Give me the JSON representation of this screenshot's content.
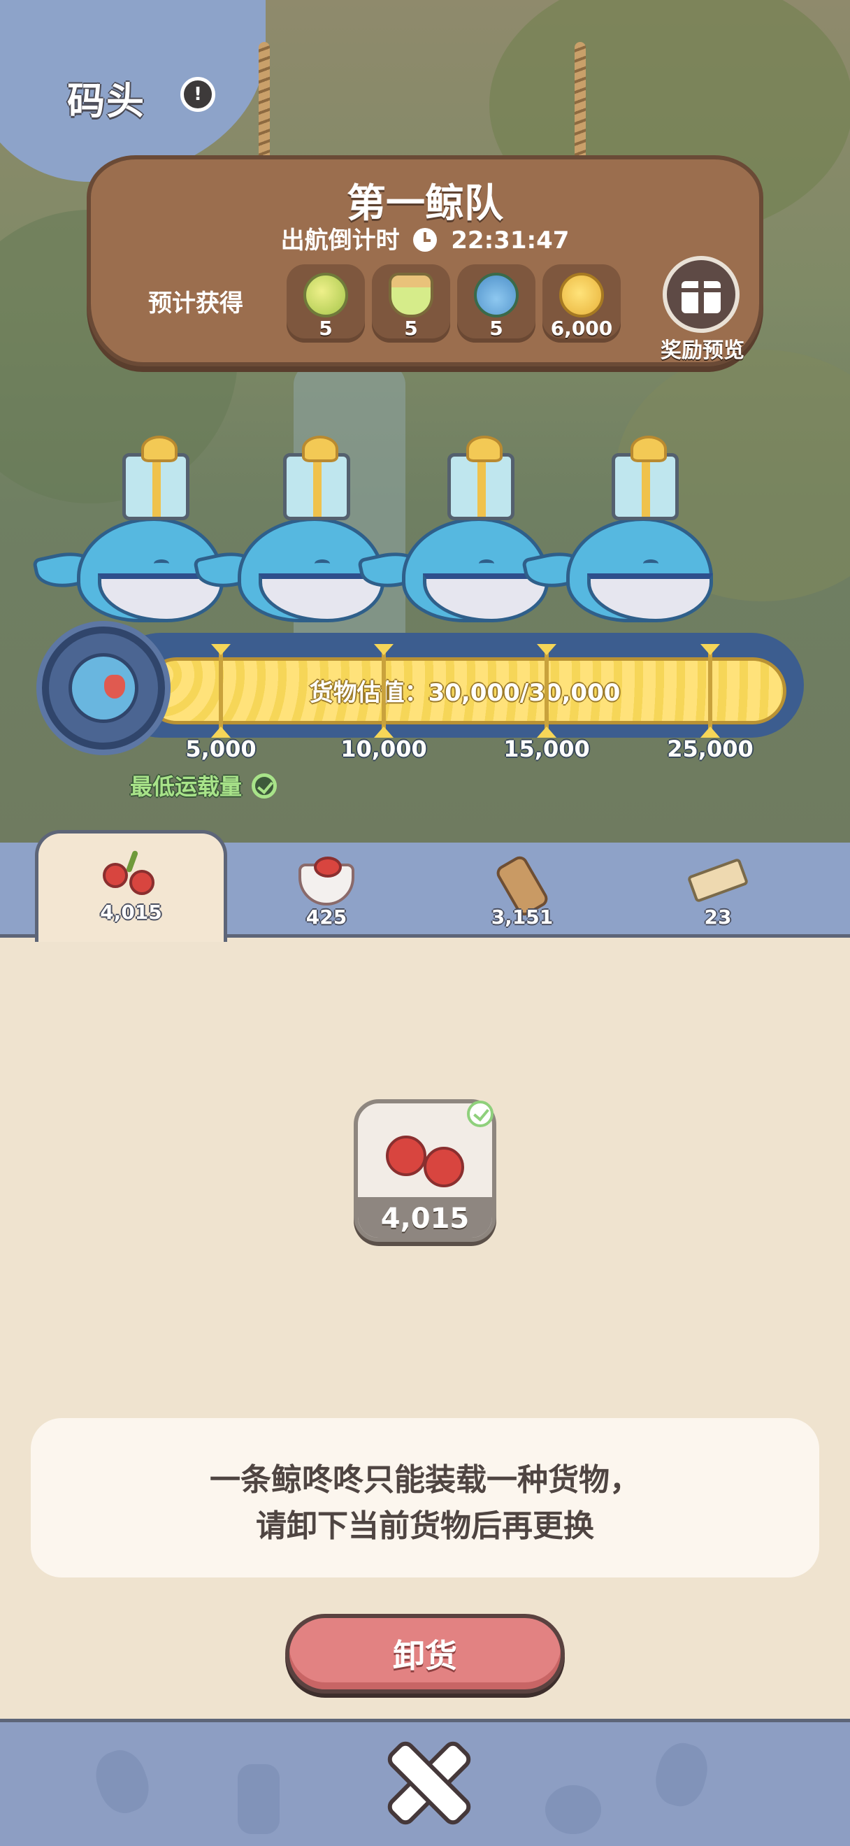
{
  "header": {
    "title": "码头"
  },
  "fleet": {
    "name": "第一鲸队",
    "countdown_label": "出航倒计时",
    "countdown_value": "22:31:47",
    "expected_label": "预计获得",
    "rewards": [
      {
        "icon": "green-orb-icon",
        "qty": "5"
      },
      {
        "icon": "potion-bottle-icon",
        "qty": "5"
      },
      {
        "icon": "bell-flower-icon",
        "qty": "5"
      },
      {
        "icon": "gold-coin-icon",
        "qty": "6,000"
      }
    ],
    "preview_label": "奖励预览"
  },
  "progress": {
    "label": "货物估值：30,000/30,000",
    "current": 30000,
    "max": 30000,
    "milestones": [
      "5,000",
      "10,000",
      "15,000",
      "25,000"
    ],
    "min_load_label": "最低运载量"
  },
  "tabs": [
    {
      "icon": "cherry-icon",
      "count": "4,015"
    },
    {
      "icon": "fruit-bowl-icon",
      "count": "425"
    },
    {
      "icon": "log-icon",
      "count": "3,151"
    },
    {
      "icon": "plank-icon",
      "count": "23"
    }
  ],
  "cargo": {
    "icon": "cherry-icon",
    "count": "4,015"
  },
  "notice": {
    "line1": "一条鲸咚咚只能装载一种货物，",
    "line2": "请卸下当前货物后再更换"
  },
  "unload_label": "卸货",
  "colors": {
    "accent_blue": "#3c5d8f",
    "bar_yellow": "#f6d658",
    "button_red": "#e28282",
    "panel_bg": "#efe3cf"
  }
}
